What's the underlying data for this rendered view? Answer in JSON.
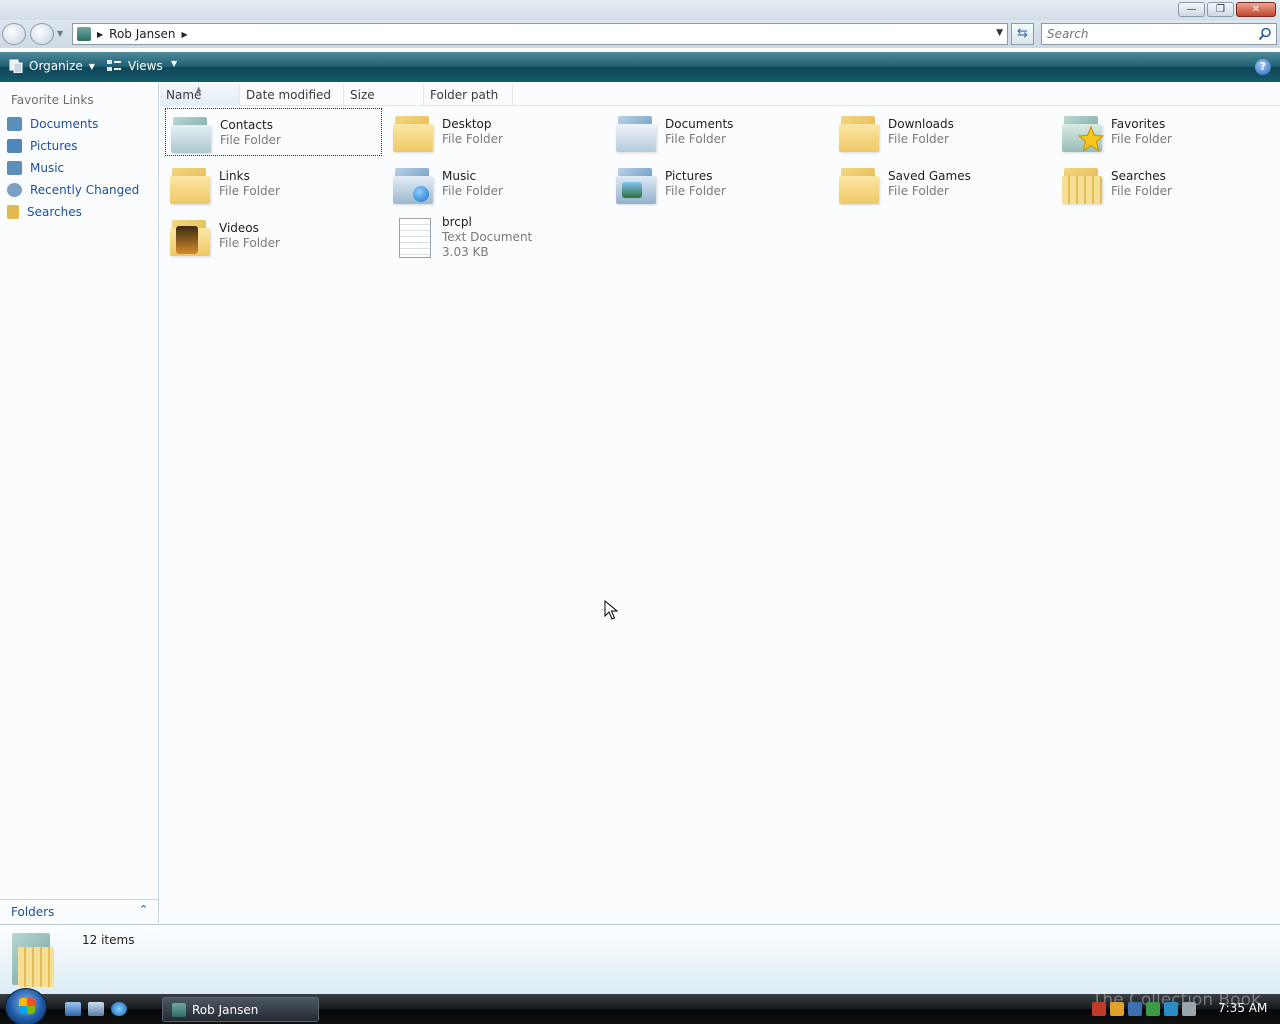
{
  "window": {
    "minimize_glyph": "—",
    "maximize_glyph": "❐",
    "close_glyph": "✕"
  },
  "address": {
    "path": "Rob Jansen",
    "separator": "▶"
  },
  "search": {
    "placeholder": "Search"
  },
  "commands": {
    "organize": "Organize",
    "views": "Views",
    "help_glyph": "?"
  },
  "left_pane": {
    "title": "Favorite Links",
    "items": [
      {
        "label": "Documents",
        "icon": "documents-icon",
        "color": "#5c8fb8"
      },
      {
        "label": "Pictures",
        "icon": "pictures-icon",
        "color": "#4d88b8"
      },
      {
        "label": "Music",
        "icon": "music-icon",
        "color": "#5c8fb8"
      },
      {
        "label": "Recently Changed",
        "icon": "recently-changed-icon",
        "color": "#7e9fc4"
      },
      {
        "label": "Searches",
        "icon": "searches-icon",
        "color": "#e2b84f"
      }
    ],
    "folders_label": "Folders",
    "folders_chevron": "⌃"
  },
  "columns": [
    "Name",
    "Date modified",
    "Size",
    "Folder path"
  ],
  "items": [
    {
      "name": "Contacts",
      "type": "File Folder",
      "icon": "contacts-folder-icon"
    },
    {
      "name": "Desktop",
      "type": "File Folder",
      "icon": "desktop-folder-icon"
    },
    {
      "name": "Documents",
      "type": "File Folder",
      "icon": "documents-folder-icon"
    },
    {
      "name": "Downloads",
      "type": "File Folder",
      "icon": "downloads-folder-icon"
    },
    {
      "name": "Favorites",
      "type": "File Folder",
      "icon": "favorites-folder-icon"
    },
    {
      "name": "Links",
      "type": "File Folder",
      "icon": "links-folder-icon"
    },
    {
      "name": "Music",
      "type": "File Folder",
      "icon": "music-folder-icon"
    },
    {
      "name": "Pictures",
      "type": "File Folder",
      "icon": "pictures-folder-icon"
    },
    {
      "name": "Saved Games",
      "type": "File Folder",
      "icon": "saved-games-folder-icon"
    },
    {
      "name": "Searches",
      "type": "File Folder",
      "icon": "searches-folder-icon"
    },
    {
      "name": "Videos",
      "type": "File Folder",
      "icon": "videos-folder-icon"
    },
    {
      "name": "brcpl",
      "type": "Text Document",
      "size": "3.03 KB",
      "icon": "text-document-icon"
    }
  ],
  "details": {
    "count": "12 items"
  },
  "taskbar": {
    "task_label": "Rob Jansen",
    "clock": "7:35 AM",
    "watermark": "The Collection Book"
  }
}
